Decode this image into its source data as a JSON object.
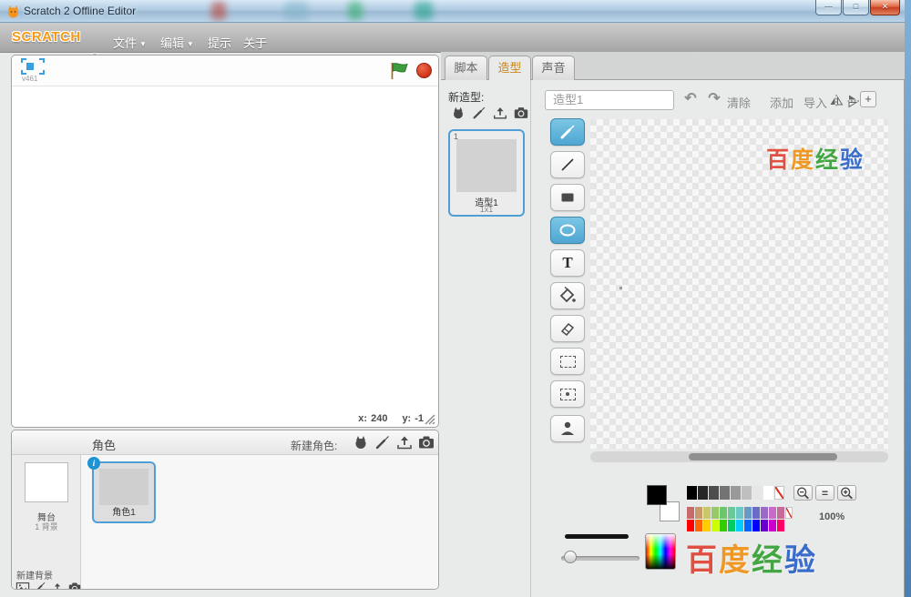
{
  "window": {
    "title": "Scratch 2 Offline Editor",
    "minimize_glyph": "—",
    "maximize_glyph": "□",
    "close_glyph": "✕"
  },
  "menubar": {
    "logo": "SCRATCH",
    "file": "文件",
    "edit": "编辑",
    "tips": "提示",
    "about": "关于",
    "arrow": "▼"
  },
  "stage": {
    "version": "v461",
    "x_label": "x:",
    "x_value": "240",
    "y_label": "y:",
    "y_value": "-1"
  },
  "sprites": {
    "header": "角色",
    "new_sprite_label": "新建角色:",
    "stage_line1": "舞台",
    "stage_line2": "1 背景",
    "new_backdrop_label": "新建背景",
    "sprite_name": "角色1",
    "info_glyph": "i"
  },
  "tabs": {
    "scripts": "脚本",
    "costumes": "造型",
    "sounds": "声音",
    "help": "?"
  },
  "costumes": {
    "new_label": "新造型:",
    "index": "1",
    "name": "造型1",
    "size": "1x1"
  },
  "paint": {
    "name_value": "造型1",
    "undo_glyph": "↶",
    "redo_glyph": "↷",
    "clear_label": "清除",
    "add_label": "添加",
    "import_label": "导入",
    "center_glyph": "+",
    "text_glyph": "T",
    "equals_glyph": "=",
    "zoom_percent": "100%",
    "fg_color": "#000000",
    "bg_color": "#ffffff",
    "palette_grays": [
      "#000000",
      "#262626",
      "#4d4d4d",
      "#737373",
      "#999999",
      "#bfbfbf",
      "#e6e6e6",
      "#ffffff"
    ],
    "palette_row1": [
      "#c86a6a",
      "#c8996a",
      "#c8c86a",
      "#99c86a",
      "#6ac86a",
      "#6ac899",
      "#6ac8c8",
      "#6a99c8",
      "#6a6ac8",
      "#996ac8",
      "#c86ac8",
      "#c86a99"
    ],
    "palette_row2": [
      "#ff0000",
      "#ff6600",
      "#ffcc00",
      "#ccff00",
      "#33cc00",
      "#00cc66",
      "#00ccff",
      "#0066ff",
      "#0000ff",
      "#6600cc",
      "#cc00cc",
      "#ff0066"
    ]
  },
  "watermark": {
    "chars": [
      "百",
      "度",
      "经",
      "验"
    ],
    "colors": [
      "#e04030",
      "#f09010",
      "#30a030",
      "#2860c8"
    ]
  }
}
